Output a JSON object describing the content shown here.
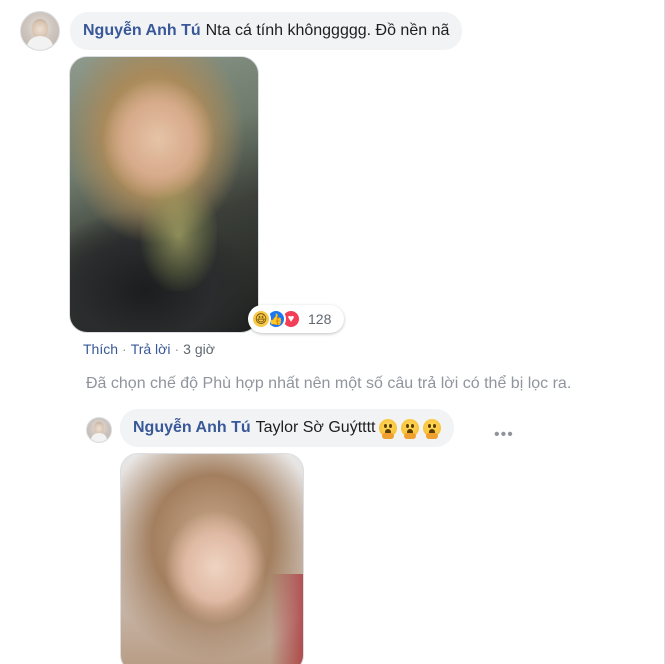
{
  "comment": {
    "author": "Nguyễn Anh Tú",
    "text": "Nta cá tính khônggggg. Đồ nền nã",
    "reactions": {
      "icons": [
        "haha-icon",
        "like-icon",
        "love-icon"
      ],
      "count": "128"
    },
    "actions": {
      "like": "Thích",
      "reply": "Trả lời",
      "time": "3 giờ"
    }
  },
  "filter_notice": "Đã chọn chế độ Phù hợp nhất nên một số câu trả lời có thể bị lọc ra.",
  "reply": {
    "author": "Nguyễn Anh Tú",
    "text": "Taylor Sờ Guýtttt",
    "emojis": [
      "face-with-open-mouth-hand-icon",
      "face-with-open-mouth-hand-icon",
      "face-with-open-mouth-hand-icon"
    ],
    "more": "•••"
  },
  "colors": {
    "name": "#385898",
    "bubble_bg": "#f2f3f5",
    "muted": "#90949c",
    "like_blue": "#1877f2",
    "love_red": "#f33e58",
    "haha_yellow": "#f7c84a"
  }
}
